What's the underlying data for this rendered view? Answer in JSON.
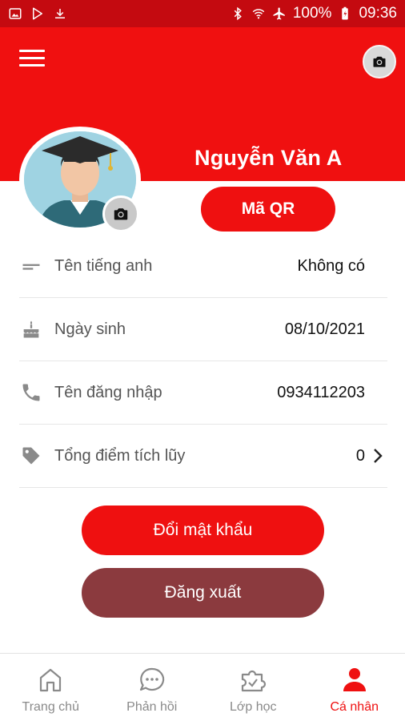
{
  "status_bar": {
    "battery": "100%",
    "time": "09:36",
    "left_icons": [
      "image-icon",
      "play-store-icon",
      "download-icon"
    ],
    "right_icons": [
      "bluetooth-icon",
      "wifi-icon",
      "airplane-icon",
      "battery-icon"
    ]
  },
  "profile": {
    "name": "Nguyễn Văn A",
    "qr_label": "Mã QR"
  },
  "info": [
    {
      "icon": "text-lines-icon",
      "label": "Tên tiếng anh",
      "value": "Không có"
    },
    {
      "icon": "birthday-cake-icon",
      "label": "Ngày sinh",
      "value": "08/10/2021"
    },
    {
      "icon": "phone-icon",
      "label": "Tên đăng nhập",
      "value": "0934112203"
    },
    {
      "icon": "tag-icon",
      "label": "Tổng điểm tích lũy",
      "value": "0"
    }
  ],
  "actions": {
    "change_password": "Đổi mật khẩu",
    "logout": "Đăng xuất"
  },
  "nav": [
    {
      "icon": "home-icon",
      "label": "Trang chủ",
      "active": false
    },
    {
      "icon": "chat-bubble-icon",
      "label": "Phản hồi",
      "active": false
    },
    {
      "icon": "class-puzzle-icon",
      "label": "Lớp học",
      "active": false
    },
    {
      "icon": "person-icon",
      "label": "Cá nhân",
      "active": true
    }
  ],
  "colors": {
    "primary_red": "#ef1010",
    "status_bar": "#c40a10",
    "logout_button": "#8b3a3e",
    "nav_inactive": "#8a8a8a"
  }
}
